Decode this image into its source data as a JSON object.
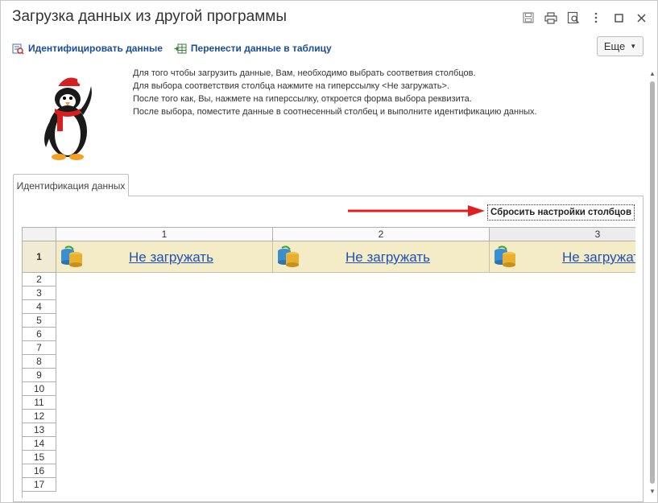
{
  "window": {
    "title": "Загрузка данных из другой программы"
  },
  "title_icons": [
    "save-icon",
    "print-icon",
    "preview-icon",
    "more-vertical-icon",
    "maximize-icon",
    "close-icon"
  ],
  "toolbar": {
    "identify_label": "Идентифицировать данные",
    "transfer_label": "Перенести данные в таблицу",
    "more_label": "Еще"
  },
  "instructions": [
    "Для того чтобы загрузить данные, Вам, необходимо выбрать соответвия столбцов.",
    "Для выбора соответствия столбца нажмите на гиперссылку <Не загружать>.",
    "После того как, Вы, нажмете на гиперссылку, откроется форма выбора реквизита.",
    "После выбора, поместите данные в соотнесенный столбец и выполните идентификацию данных."
  ],
  "tab": {
    "label": "Идентификация данных"
  },
  "reset_button": {
    "label": "Сбросить настройки столбцов"
  },
  "grid": {
    "columns": [
      "1",
      "2",
      "3"
    ],
    "rows": [
      "1",
      "2",
      "3",
      "4",
      "5",
      "6",
      "7",
      "8",
      "9",
      "10",
      "11",
      "12",
      "13",
      "14",
      "15",
      "16",
      "17"
    ],
    "header_row_link": "Не загружать"
  },
  "colors": {
    "link": "#1d52b8",
    "header_row_bg": "#f3ecc6",
    "annotation_arrow": "#e02020"
  }
}
